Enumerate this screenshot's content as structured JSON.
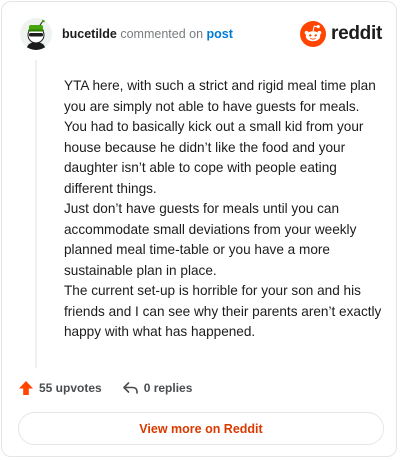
{
  "header": {
    "author": "bucetilde",
    "verb": "commented on",
    "target": "post",
    "brand": "reddit"
  },
  "comment": {
    "paragraphs": [
      "YTA here, with such a strict and rigid meal time plan you are simply not able to have guests for meals. You had to basically kick out a small kid from your house because he didn’t like the food and your daughter isn’t able to cope with people eating different things.",
      "Just don’t have guests for meals until you can accommodate small deviations from your weekly planned meal time-table or you have a more sustainable plan in place.",
      "The current set-up is horrible for your son and his friends and I can see why their parents aren’t exactly happy with what has happened."
    ]
  },
  "actions": {
    "upvotes": "55 upvotes",
    "replies": "0 replies"
  },
  "footer": {
    "view_more": "View more on Reddit"
  },
  "colors": {
    "brand": "#ff4500",
    "link": "#0079d3",
    "cta": "#d93a00"
  },
  "icons": {
    "avatar": "snoo-avatar-green-hat",
    "brand": "reddit-snoo-logo",
    "upvote": "upvote-arrow-icon",
    "reply": "reply-arrow-icon"
  }
}
